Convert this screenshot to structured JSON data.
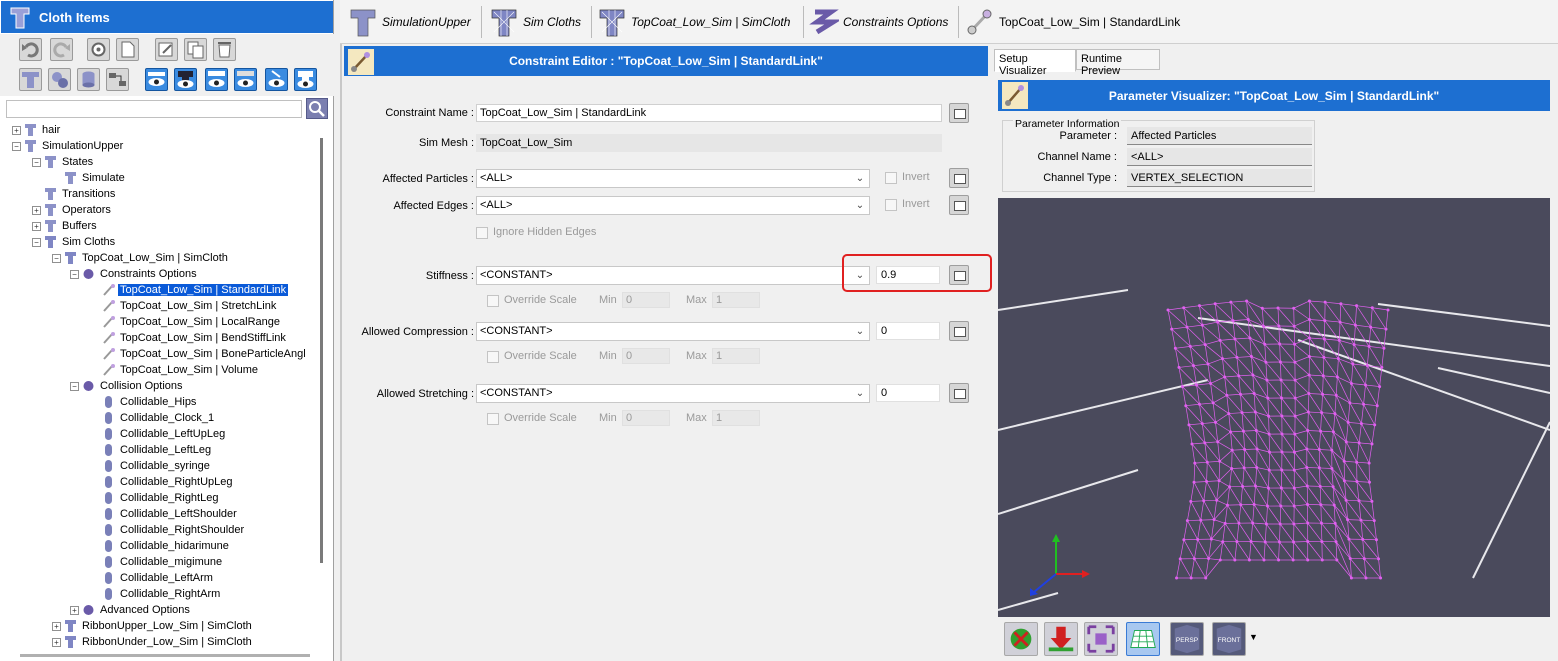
{
  "left_panel": {
    "title": "Cloth Items",
    "search_placeholder": "",
    "tree": [
      {
        "label": "hair",
        "depth": 0,
        "expander": "+"
      },
      {
        "label": "SimulationUpper",
        "depth": 0,
        "expander": "-"
      },
      {
        "label": "States",
        "depth": 1,
        "expander": "-"
      },
      {
        "label": "Simulate",
        "depth": 2,
        "expander": ""
      },
      {
        "label": "Transitions",
        "depth": 1,
        "expander": ""
      },
      {
        "label": "Operators",
        "depth": 1,
        "expander": "+"
      },
      {
        "label": "Buffers",
        "depth": 1,
        "expander": "+"
      },
      {
        "label": "Sim Cloths",
        "depth": 1,
        "expander": "-"
      },
      {
        "label": "TopCoat_Low_Sim | SimCloth",
        "depth": 2,
        "expander": "-"
      },
      {
        "label": "Constraints Options",
        "depth": 3,
        "expander": "-"
      },
      {
        "label": "TopCoat_Low_Sim | StandardLink",
        "depth": 4,
        "expander": "",
        "selected": true
      },
      {
        "label": "TopCoat_Low_Sim | StretchLink",
        "depth": 4,
        "expander": ""
      },
      {
        "label": "TopCoat_Low_Sim | LocalRange",
        "depth": 4,
        "expander": ""
      },
      {
        "label": "TopCoat_Low_Sim | BendStiffLink",
        "depth": 4,
        "expander": ""
      },
      {
        "label": "TopCoat_Low_Sim | BoneParticleAngl",
        "depth": 4,
        "expander": ""
      },
      {
        "label": "TopCoat_Low_Sim | Volume",
        "depth": 4,
        "expander": ""
      },
      {
        "label": "Collision Options",
        "depth": 3,
        "expander": "-"
      },
      {
        "label": "Collidable_Hips",
        "depth": 4,
        "expander": ""
      },
      {
        "label": "Collidable_Clock_1",
        "depth": 4,
        "expander": ""
      },
      {
        "label": "Collidable_LeftUpLeg",
        "depth": 4,
        "expander": ""
      },
      {
        "label": "Collidable_LeftLeg",
        "depth": 4,
        "expander": ""
      },
      {
        "label": "Collidable_syringe",
        "depth": 4,
        "expander": ""
      },
      {
        "label": "Collidable_RightUpLeg",
        "depth": 4,
        "expander": ""
      },
      {
        "label": "Collidable_RightLeg",
        "depth": 4,
        "expander": ""
      },
      {
        "label": "Collidable_LeftShoulder",
        "depth": 4,
        "expander": ""
      },
      {
        "label": "Collidable_RightShoulder",
        "depth": 4,
        "expander": ""
      },
      {
        "label": "Collidable_hidarimune",
        "depth": 4,
        "expander": ""
      },
      {
        "label": "Collidable_migimune",
        "depth": 4,
        "expander": ""
      },
      {
        "label": "Collidable_LeftArm",
        "depth": 4,
        "expander": ""
      },
      {
        "label": "Collidable_RightArm",
        "depth": 4,
        "expander": ""
      },
      {
        "label": "Advanced Options",
        "depth": 3,
        "expander": "+"
      },
      {
        "label": "RibbonUpper_Low_Sim | SimCloth",
        "depth": 2,
        "expander": "+"
      },
      {
        "label": "RibbonUnder_Low_Sim | SimCloth",
        "depth": 2,
        "expander": "+"
      }
    ]
  },
  "breadcrumbs": [
    {
      "label": "SimulationUpper",
      "italic": true
    },
    {
      "label": "Sim Cloths",
      "italic": true
    },
    {
      "label": "TopCoat_Low_Sim | SimCloth",
      "italic": true
    },
    {
      "label": "Constraints Options",
      "italic": true
    },
    {
      "label": "TopCoat_Low_Sim | StandardLink",
      "italic": false
    }
  ],
  "editor": {
    "title": "Constraint Editor : \"TopCoat_Low_Sim | StandardLink\"",
    "constraint_name_label": "Constraint Name :",
    "constraint_name_value": "TopCoat_Low_Sim | StandardLink",
    "sim_mesh_label": "Sim Mesh :",
    "sim_mesh_value": "TopCoat_Low_Sim",
    "affected_particles_label": "Affected Particles :",
    "affected_particles_value": "<ALL>",
    "affected_edges_label": "Affected Edges :",
    "affected_edges_value": "<ALL>",
    "invert_label": "Invert",
    "ignore_hidden_edges_label": "Ignore Hidden Edges",
    "stiffness_label": "Stiffness :",
    "stiffness_combo": "<CONSTANT>",
    "stiffness_value": "0.9",
    "allowed_compression_label": "Allowed Compression :",
    "allowed_compression_combo": "<CONSTANT>",
    "allowed_compression_value": "0",
    "allowed_stretching_label": "Allowed Stretching :",
    "allowed_stretching_combo": "<CONSTANT>",
    "allowed_stretching_value": "0",
    "override_scale_label": "Override Scale",
    "min_label": "Min",
    "max_label": "Max",
    "min_value": "0",
    "max_value": "1"
  },
  "visualizer": {
    "tabs": [
      "Setup Visualizer",
      "Runtime Preview"
    ],
    "active_tab": "Setup Visualizer",
    "title": "Parameter Visualizer: \"TopCoat_Low_Sim | StandardLink\"",
    "info_title": "Parameter Information",
    "parameter_label": "Parameter :",
    "parameter_value": "Affected Particles",
    "channel_name_label": "Channel Name :",
    "channel_name_value": "<ALL>",
    "channel_type_label": "Channel Type :",
    "channel_type_value": "VERTEX_SELECTION",
    "toolbar": [
      "PERSP",
      "FRONT"
    ]
  },
  "colors": {
    "header_blue": "#1d6fd1",
    "selection_blue": "#0a5ad8",
    "mesh_magenta": "#e060f0",
    "viewport_bg": "#4a4a5c",
    "highlight_red": "#e02020"
  }
}
